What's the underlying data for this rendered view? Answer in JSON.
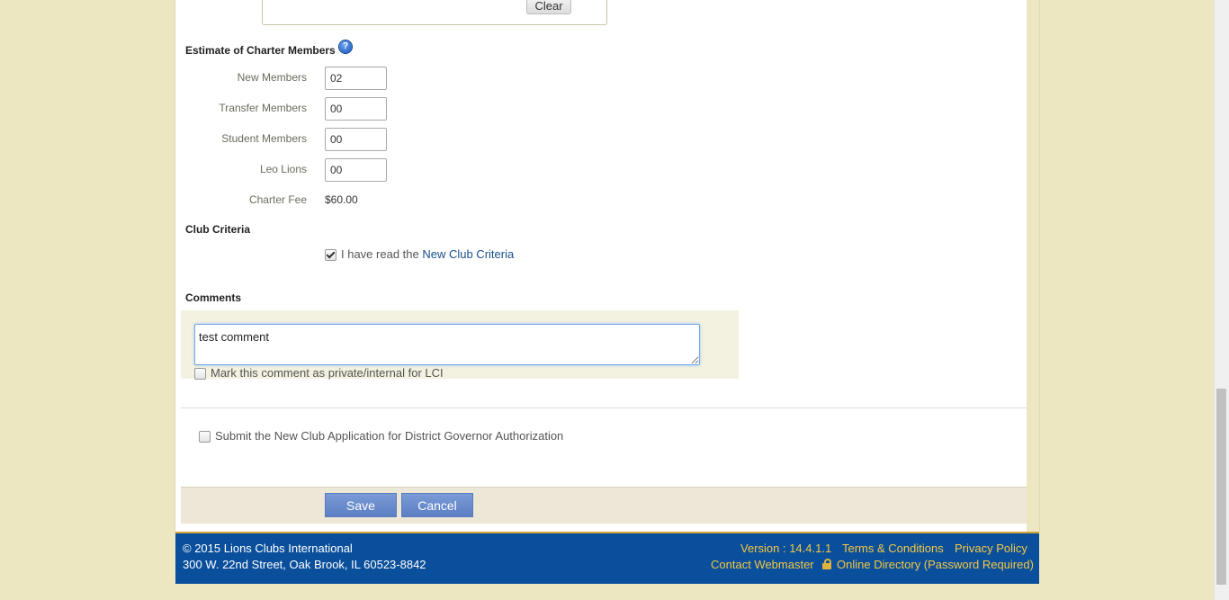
{
  "signature": {
    "clear_label": "Clear"
  },
  "charter": {
    "section_title": "Estimate of Charter Members",
    "help_icon": "question-icon",
    "fields": [
      {
        "label": "New Members",
        "value": "02"
      },
      {
        "label": "Transfer Members",
        "value": "00"
      },
      {
        "label": "Student Members",
        "value": "00"
      },
      {
        "label": "Leo Lions",
        "value": "00"
      }
    ],
    "fee_label": "Charter Fee",
    "fee_value": "$60.00"
  },
  "criteria": {
    "section_title": "Club Criteria",
    "checked": true,
    "text": "I have read the ",
    "link": "New Club Criteria"
  },
  "comments": {
    "section_title": "Comments",
    "value": "test comment",
    "private_label": "Mark this comment as private/internal for LCI",
    "private_checked": false
  },
  "submit": {
    "label": "Submit the New Club Application for District Governor Authorization",
    "checked": false
  },
  "buttons": {
    "save": "Save",
    "cancel": "Cancel"
  },
  "footer": {
    "copyright": "© 2015 Lions Clubs International",
    "address": "300 W. 22nd Street, Oak Brook, IL 60523-8842",
    "version": "Version : 14.4.1.1",
    "terms": "Terms & Conditions",
    "privacy": "Privacy Policy",
    "contact": "Contact Webmaster",
    "directory": "Online Directory (Password Required)"
  },
  "colors": {
    "page_bg": "#ece7c1",
    "footer_bg": "#0a4f9c",
    "footer_link": "#f5c842",
    "button": "#6a8ccd"
  }
}
